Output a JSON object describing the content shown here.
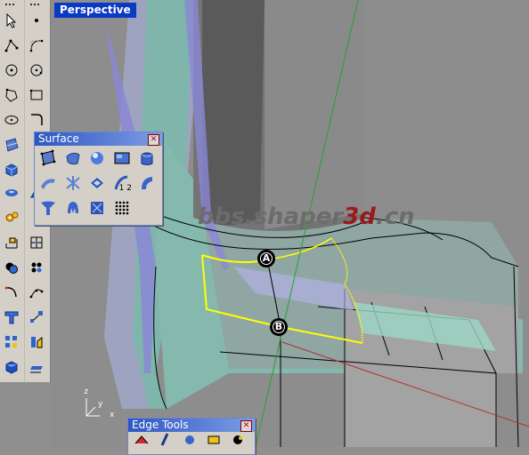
{
  "viewport": {
    "title": "Perspective"
  },
  "watermark": {
    "part1": "bbs.shaper",
    "highlight": "3d",
    "part2": ".cn"
  },
  "points": {
    "a": "A",
    "b": "B"
  },
  "axis": {
    "x": "x",
    "y": "y",
    "z": "z"
  },
  "surface_palette": {
    "title": "Surface",
    "close": "✕",
    "buttons": [
      {
        "name": "surface-from-points",
        "label": ""
      },
      {
        "name": "surface-from-edge-curves",
        "label": ""
      },
      {
        "name": "surface-sphere",
        "label": ""
      },
      {
        "name": "surface-plane",
        "label": ""
      },
      {
        "name": "surface-extrude",
        "label": ""
      },
      {
        "name": "surface-sweep",
        "label": ""
      },
      {
        "name": "surface-network",
        "label": ""
      },
      {
        "name": "surface-loft",
        "label": ""
      },
      {
        "name": "surface-sweep-1-2",
        "label": "1 2"
      },
      {
        "name": "surface-revolve",
        "label": ""
      },
      {
        "name": "surface-patch",
        "label": ""
      },
      {
        "name": "surface-patch-extend",
        "label": ""
      },
      {
        "name": "surface-drape",
        "label": ""
      },
      {
        "name": "surface-point-grid",
        "label": ""
      }
    ]
  },
  "edge_palette": {
    "title": "Edge Tools",
    "close": "✕"
  },
  "colors": {
    "accent": "#0a39c4",
    "curve_highlight": "#ffff00",
    "surface_teal": "#86b9ad",
    "surface_purple": "#8a87d6"
  }
}
